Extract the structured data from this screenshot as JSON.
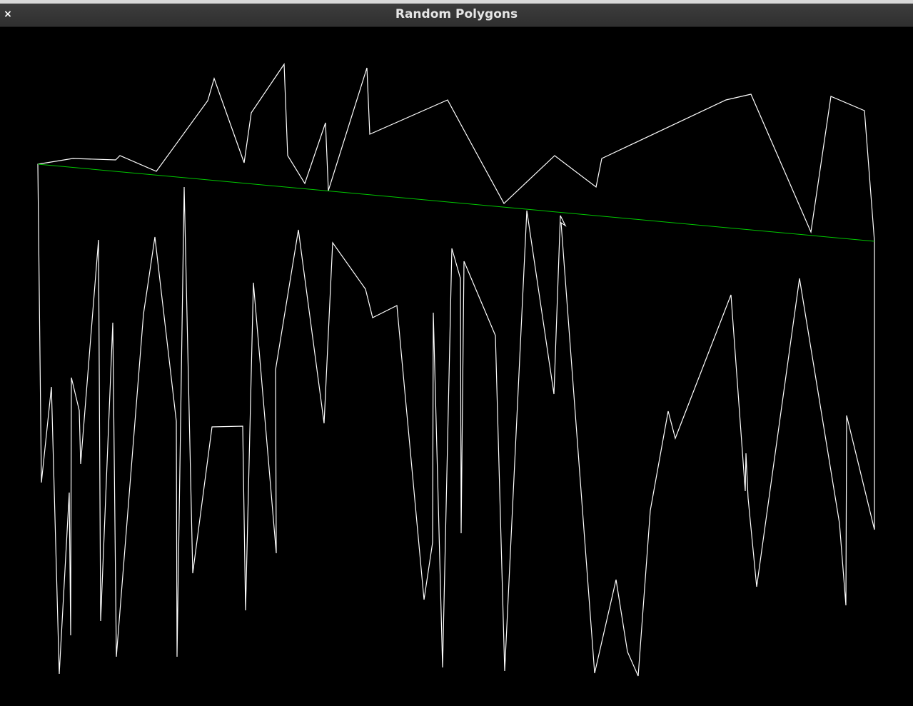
{
  "window": {
    "title": "Random Polygons",
    "close_label": "×"
  },
  "canvas": {
    "background": "#000000",
    "polygon_color": "#ffffff",
    "line_color": "#00c800"
  }
}
